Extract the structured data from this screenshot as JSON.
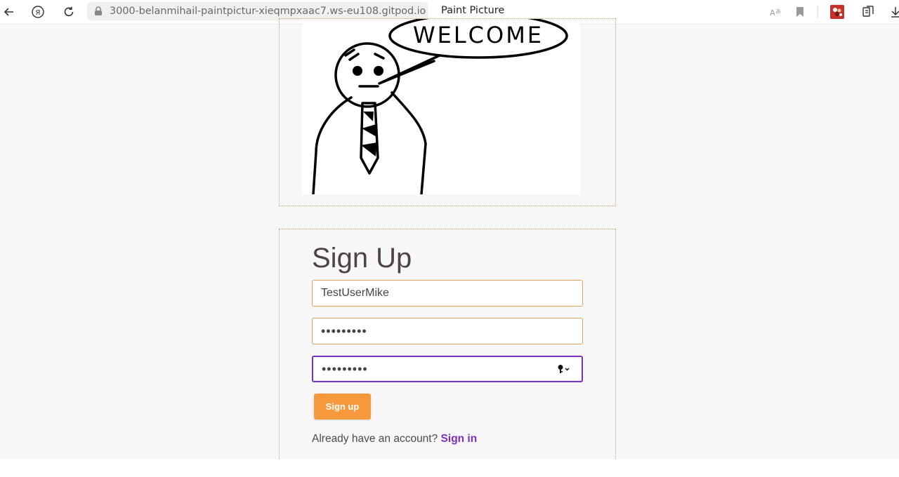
{
  "browser": {
    "url": "3000-belanmihail-paintpictur-xieqmpxaac7.ws-eu108.gitpod.io",
    "page_title": "Paint Picture",
    "icons": [
      "back-arrow-icon",
      "yandex-icon",
      "reload-icon",
      "lock-icon",
      "translate-icon",
      "bookmark-icon",
      "extension-icon",
      "collections-icon",
      "download-icon"
    ]
  },
  "welcome": {
    "bubble_text": "WELCOME"
  },
  "signup": {
    "title": "Sign Up",
    "username_value": "TestUserMike",
    "password_value": "•••••••••",
    "confirm_password_value": "•••••••••",
    "submit_label": "Sign up",
    "account_prompt": "Already have an account?",
    "signin_label": "Sign in"
  },
  "colors": {
    "accent_orange": "#f6993d",
    "focus_purple": "#7b2fc4",
    "link_purple": "#7b2fc4",
    "border_orange": "#e09f5a",
    "page_bg": "#f7f7f7"
  }
}
